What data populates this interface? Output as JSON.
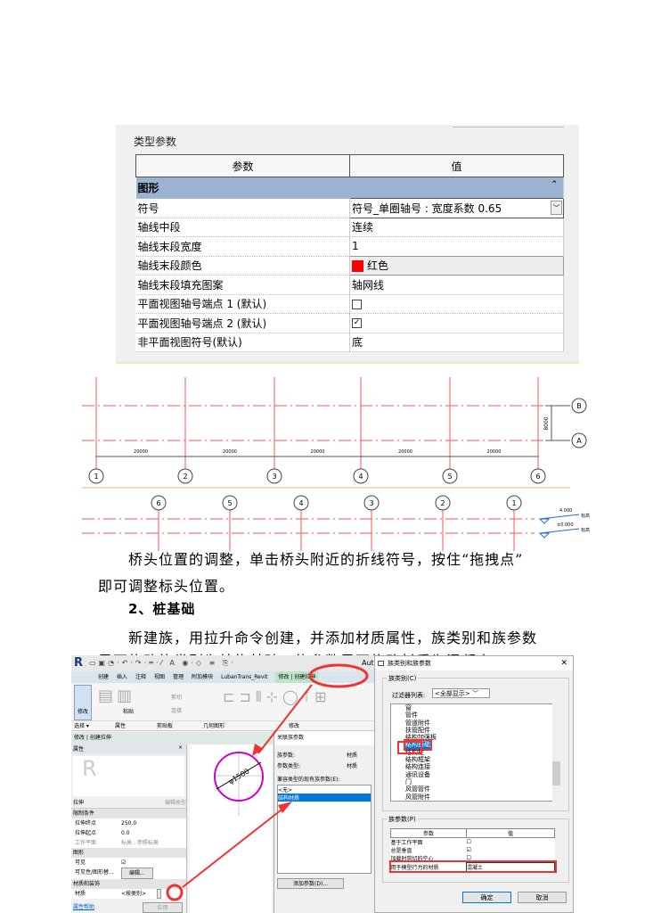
{
  "type_params": {
    "title": "类型参数",
    "col_param": "参数",
    "col_value": "值",
    "group": "图形",
    "collapse_icon": "⌃",
    "rows": [
      {
        "param": "符号",
        "value": "符号_单圈轴号 : 宽度系数 0.65"
      },
      {
        "param": "轴线中段",
        "value": "连续"
      },
      {
        "param": "轴线末段宽度",
        "value": "1"
      },
      {
        "param": "轴线末段颜色",
        "value": "红色",
        "color": "#ff0000"
      },
      {
        "param": "轴线末段填充图案",
        "value": "轴网线"
      },
      {
        "param": "平面视图轴号端点 1 (默认)",
        "value": "☐"
      },
      {
        "param": "平面视图轴号端点 2 (默认)",
        "value": "☑"
      },
      {
        "param": "非平面视图符号(默认)",
        "value": "底"
      }
    ]
  },
  "grid_plan": {
    "axes_numbers": [
      "1",
      "2",
      "3",
      "4",
      "5",
      "6"
    ],
    "spans": [
      "20000",
      "20000",
      "20000",
      "20000",
      "20000"
    ],
    "axes_letters": [
      "B",
      "A"
    ],
    "letter_span": "8000",
    "elev_axes": [
      "6",
      "5",
      "4",
      "3",
      "2",
      "1"
    ],
    "levels": [
      {
        "value": "4.000",
        "label": "标高"
      },
      {
        "value": "±0.000",
        "label": "标高"
      }
    ]
  },
  "text": {
    "p1": "桥头位置的调整，单击桥头附近的折线符号，按住“拖拽点”",
    "p1b": "即可调整标头位置。",
    "heading": "2、桩基础",
    "p2": "新建族，用拉升命令创建，并添加材质属性，族类别和族参数",
    "p2b": "界面修改族类别为结构基础，族参数界面修改材质为混凝土"
  },
  "revit": {
    "app_title": "Aut",
    "tabs": [
      "创建",
      "插入",
      "注释",
      "视图",
      "管理",
      "附加模块",
      "LubanTrans_Revit",
      "修改 | 创建拉伸"
    ],
    "panels": [
      "选择 ▾",
      "属性",
      "剪贴板",
      "几何图形",
      "修改"
    ],
    "tool_labels": {
      "modify": "修改",
      "paste": "粘贴",
      "cut": "剪切",
      "join": "连接"
    },
    "context": "修改 | 创建拉伸",
    "props_title": "属性",
    "type_selector": "拉伸",
    "edit_type": "编辑类型",
    "groups": {
      "constraints": "限制条件",
      "graphics": "图形",
      "materials": "材质和装饰"
    },
    "props": [
      {
        "name": "拉伸终点",
        "value": "250.0"
      },
      {
        "name": "拉伸起点",
        "value": "0.0"
      },
      {
        "name": "工作平面",
        "value": "标高 : 参照标高"
      },
      {
        "name": "可见",
        "value": "☑"
      },
      {
        "name": "可见性/图形替...",
        "value": "编辑..."
      },
      {
        "name": "材质",
        "value": "<按类别>"
      }
    ],
    "help": "属性帮助",
    "apply": "应用",
    "dimension": "φ1500",
    "assoc": {
      "title": "关联族参数",
      "fp_label": "族参数:",
      "fp_value": "材质",
      "pt_label": "参数类型:",
      "pt_value": "材质",
      "list_label": "兼容类型的现有族参数(E):",
      "items": [
        "<无>",
        "结构材质"
      ],
      "add": "添加参数(D)..."
    }
  },
  "dialog": {
    "title": "族类别和族参数",
    "category_group": "族类别(C)",
    "filter_label": "过滤器列表:",
    "filter_value": "<全部显示>",
    "categories": [
      "窗",
      "管件",
      "管道附件",
      "扶管配件",
      "结构加强板",
      "结构基础",
      "结构柱",
      "结构框架",
      "结构连接",
      "通讯设备",
      "门",
      "风管管件",
      "风管附件"
    ],
    "selected": "结构基础",
    "params_group": "族参数(P)",
    "cols": [
      "参数",
      "值"
    ],
    "rows": [
      {
        "param": "基于工作平面",
        "value": "☐"
      },
      {
        "param": "总是垂直",
        "value": "☑"
      },
      {
        "param": "加载时剪切的空心",
        "value": "☐"
      },
      {
        "param": "用于模型行为的材质",
        "value": "混凝土"
      }
    ],
    "ok": "确定",
    "cancel": "取消"
  }
}
